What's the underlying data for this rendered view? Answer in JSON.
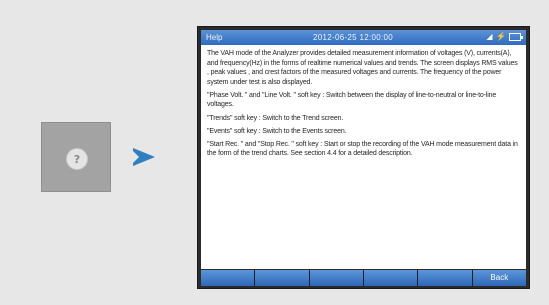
{
  "help_key": {
    "icon": "help-question-icon",
    "glyph": "?"
  },
  "arrow": {
    "icon": "arrow-right-icon",
    "color": "#2f7fc0"
  },
  "screen": {
    "title": "Help",
    "datetime": "2012-06-25 12:00:00",
    "status_icons": [
      "signal-icon",
      "usb-icon",
      "battery-icon"
    ],
    "paragraphs": [
      "The VAH mode of the Analyzer provides detailed measurement information of voltages (V), currents(A), and frequency(Hz) in the forms of realtime numerical values and trends. The screen displays RMS values , peak values , and crest factors of the measured voltages and currents. The frequency of the power system under test is also displayed.",
      "\"Phase Volt. \" and \"Line Volt. \" soft key : Switch between the display of line-to-neutral or line-to-line voltages.",
      "\"Trends\" soft key : Switch to the Trend screen.",
      "\"Events\" soft key : Switch to the Events screen.",
      "\"Start Rec. \" and \"Stop Rec. \" soft key : Start or stop the recording of the VAH mode measurement data in the form of the trend charts. See section 4.4 for a detailed description."
    ],
    "softkeys": [
      "",
      "",
      "",
      "",
      "",
      "Back"
    ],
    "colors": {
      "titlebar": "#3b78c8",
      "softkey": "#3a74c2"
    }
  }
}
